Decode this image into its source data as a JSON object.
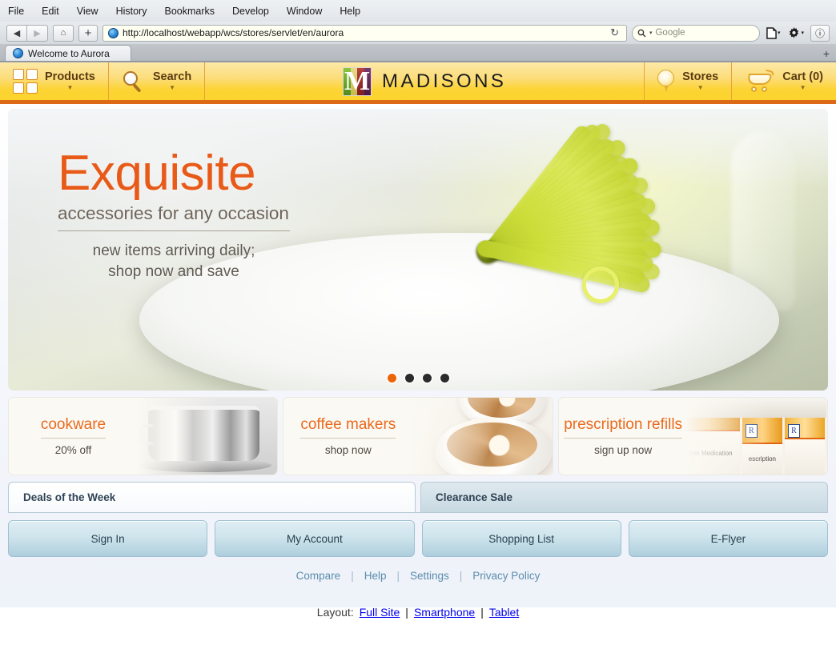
{
  "browser": {
    "menus": [
      "File",
      "Edit",
      "View",
      "History",
      "Bookmarks",
      "Develop",
      "Window",
      "Help"
    ],
    "back_icon": "◀",
    "forward_icon": "▶",
    "home_icon": "⌂",
    "newtab_icon": "+",
    "url": "http://localhost/webapp/wcs/stores/servlet/en/aurora",
    "reload_icon": "↻",
    "search_placeholder": "Google",
    "search_icon": "search-icon",
    "page_icon": "page-icon",
    "gear_icon": "gear-icon",
    "reader_icon": "ⓘ",
    "caret": "▾",
    "tab_title": "Welcome to Aurora",
    "new_tab_plus": "+"
  },
  "site": {
    "nav_left": [
      {
        "label": "Products",
        "icon": "grid-icon",
        "caret": "▼"
      },
      {
        "label": "Search",
        "icon": "magnifier-icon",
        "caret": "▼"
      }
    ],
    "nav_right": [
      {
        "label": "Stores",
        "icon": "map-pin-icon",
        "caret": "▼"
      },
      {
        "label": "Cart (0)",
        "icon": "shopping-cart-icon",
        "caret": "▼"
      }
    ],
    "brand": "MADISONS",
    "brand_mark_letter": "M",
    "brand_mark_colors": [
      "#6fa82b",
      "#c9b84a",
      "#8a1f2a",
      "#5c2150"
    ],
    "accent_color": "#ea6a1e",
    "nav_bar_color": "#fcd434",
    "nav_border_color": "#dd6a17"
  },
  "hero": {
    "title": "Exquisite",
    "subtitle": "accessories for any occasion",
    "tagline_line1": "new items arriving daily;",
    "tagline_line2": "shop now and save",
    "title_color": "#e85a18",
    "dots": [
      {
        "active": true
      },
      {
        "active": false
      },
      {
        "active": false
      },
      {
        "active": false
      }
    ]
  },
  "promos": [
    {
      "title": "cookware",
      "subtitle": "20% off",
      "image": "cooking-pot-photo"
    },
    {
      "title": "coffee makers",
      "subtitle": "shop now",
      "image": "latte-cups-photo"
    },
    {
      "title": "prescription refills",
      "subtitle": "sign up now",
      "image": "pill-bottles-photo",
      "label1": "iption Medication",
      "label2": "escription",
      "rx1": "R",
      "rx2": "R"
    }
  ],
  "content_tabs": [
    {
      "label": "Deals of the Week",
      "active": true
    },
    {
      "label": "Clearance Sale",
      "active": false
    }
  ],
  "actions": [
    "Sign In",
    "My Account",
    "Shopping List",
    "E-Flyer"
  ],
  "footer": {
    "links": [
      "Compare",
      "Help",
      "Settings",
      "Privacy Policy"
    ],
    "separator": "|"
  },
  "layout_switcher": {
    "label": "Layout:",
    "options": [
      "Full Site",
      "Smartphone",
      "Tablet"
    ],
    "separator": "|"
  }
}
